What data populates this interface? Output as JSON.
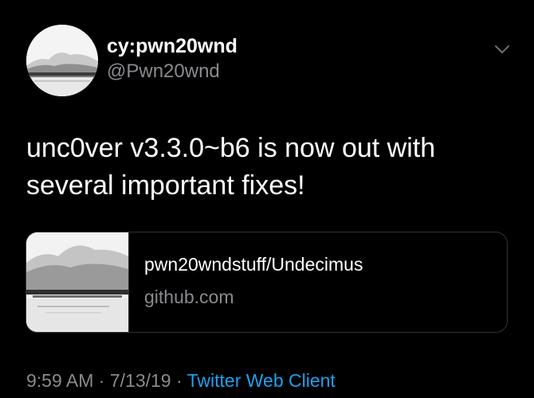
{
  "author": {
    "display_name": "cy:pwn20wnd",
    "username": "@Pwn20wnd"
  },
  "tweet": {
    "text": "unc0ver v3.3.0~b6 is now out with several important fixes!"
  },
  "card": {
    "title": "pwn20wndstuff/Undecimus",
    "domain": "github.com"
  },
  "meta": {
    "time": "9:59 AM",
    "separator_1": " · ",
    "date": "7/13/19",
    "separator_2": " · ",
    "client": "Twitter Web Client"
  },
  "icons": {
    "more": "chevron-down-icon"
  },
  "colors": {
    "background": "#000000",
    "primary_text": "#ffffff",
    "secondary_text": "#8a8a8f",
    "link": "#1da1f2",
    "card_border": "#2f3336"
  }
}
